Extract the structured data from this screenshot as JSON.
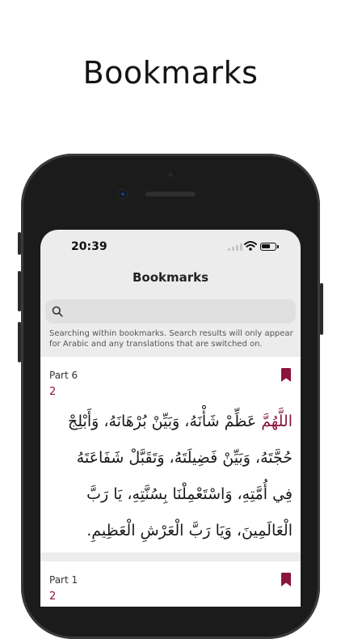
{
  "headline": "Bookmarks",
  "status_bar": {
    "time": "20:39"
  },
  "nav": {
    "title": "Bookmarks"
  },
  "search": {
    "placeholder": "",
    "hint": "Searching within bookmarks. Search results will only appear for Arabic and any translations that are switched on."
  },
  "bookmarks": [
    {
      "part": "Part 6",
      "number": "2",
      "arabic_highlight": "اللَّهُمَّ",
      "arabic_text": " عَظِّمْ شَأْنَهُ، وَبَيِّنْ بُرْهَانَهُ، وَأَبْلِجْ حُجَّتَهُ، وَبَيِّنْ فَضِيلَتَهُ، وَتَقَبَّلْ شَفَاعَتَهُ فِي أُمَّتِهِ، وَاسْتَعْمِلْنَا بِسُنَّتِهِ، يَا رَبَّ الْعَالَمِينَ، وَيَا رَبَّ الْعَرْشِ الْعَظِيمِ."
    },
    {
      "part": "Part 1",
      "number": "2"
    }
  ],
  "colors": {
    "accent": "#8a1538",
    "screen_bg": "#ececec",
    "card_bg": "#ffffff"
  },
  "icons": {
    "search": "search-icon",
    "bookmark": "bookmark-icon",
    "wifi": "wifi-icon",
    "battery": "battery-icon",
    "signal": "signal-icon"
  }
}
